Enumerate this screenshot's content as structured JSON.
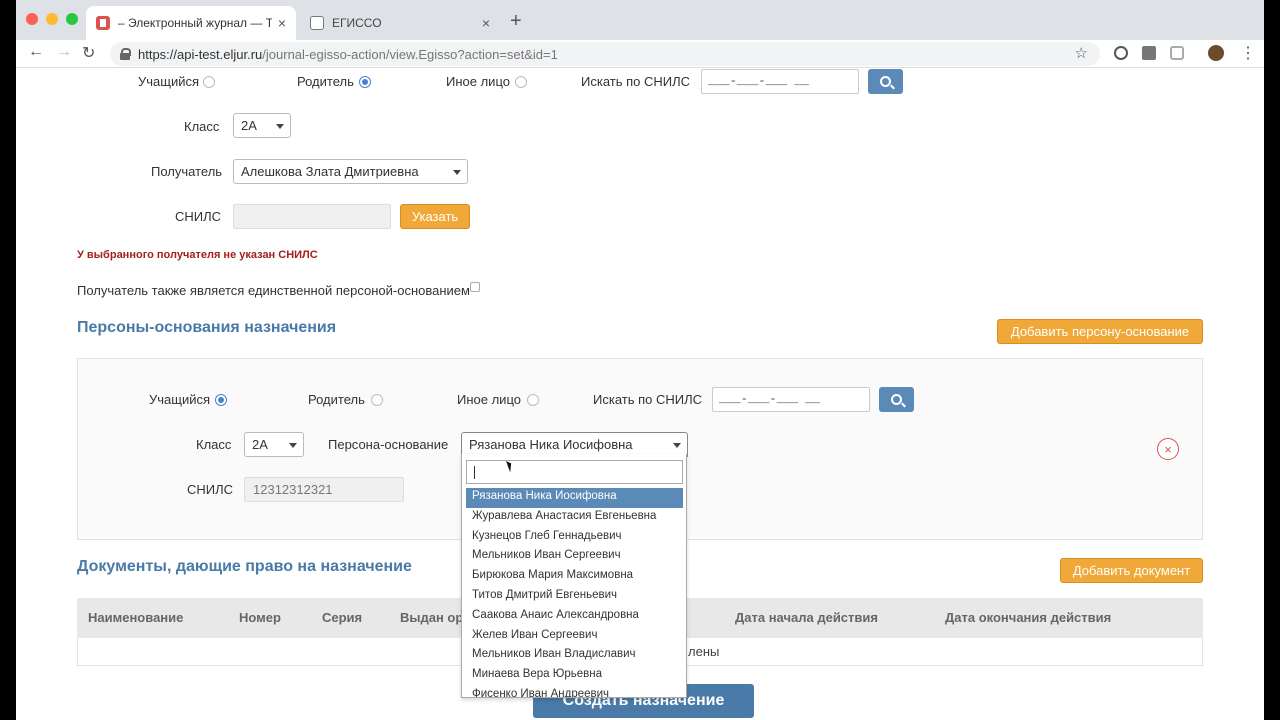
{
  "browser": {
    "tabs": [
      {
        "title": "– Электронный журнал — Тес",
        "active": true
      },
      {
        "title": "ЕГИССО",
        "active": false
      }
    ],
    "url_host": "https://api-test.eljur.ru",
    "url_path": "/journal-egisso-action/view.Egisso?action=set&id=1"
  },
  "recipient_form": {
    "radio_student": "Учащийся",
    "radio_parent": "Родитель",
    "radio_other": "Иное лицо",
    "search_snils_label": "Искать по СНИЛС",
    "snils_mask": "___-___-___ __",
    "class_label": "Класс",
    "class_value": "2А",
    "recipient_label": "Получатель",
    "recipient_value": "Алешкова Злата Дмитриевна",
    "snils_label": "СНИЛС",
    "specify_button": "Указать",
    "warning": "У выбранного получателя не указан СНИЛС",
    "sole_person_label": "Получатель также является единственной персоной-основанием"
  },
  "persons_section": {
    "title": "Персоны-основания назначения",
    "add_button": "Добавить персону-основание",
    "radio_student": "Учащийся",
    "radio_parent": "Родитель",
    "radio_other": "Иное лицо",
    "search_snils_label": "Искать по СНИЛС",
    "snils_mask": "___-___-___ __",
    "class_label": "Класс",
    "class_value": "2А",
    "person_label": "Персона-основание",
    "person_value": "Рязанова Ника Иосифовна",
    "snils_label": "СНИЛС",
    "snils_value": "12312312321",
    "remove_icon": "×"
  },
  "documents_section": {
    "title": "Документы, дающие право на назначение",
    "add_button": "Добавить документ",
    "columns": [
      "Наименование",
      "Номер",
      "Серия",
      "Выдан ор",
      "Дата начала действия",
      "Дата окончания действия"
    ],
    "empty_fragment": "лены"
  },
  "create_button": "Создать назначение",
  "dropdown": {
    "options": [
      "Рязанова Ника Иосифовна",
      "Журавлева Анастасия Евгеньевна",
      "Кузнецов Глеб Геннадьевич",
      "Мельников Иван Сергеевич",
      "Бирюкова Мария Максимовна",
      "Титов Дмитрий Евгеньевич",
      "Саакова Анаис Александровна",
      "Желев Иван Сергеевич",
      "Мельников Иван Владиславич",
      "Минаева Вера Юрьевна",
      "Фисенко Иван Андреевич"
    ],
    "selected_index": 0
  },
  "colors": {
    "accent_blue": "#4a7aa8",
    "orange": "#f0a838",
    "warning_red": "#a02020"
  }
}
